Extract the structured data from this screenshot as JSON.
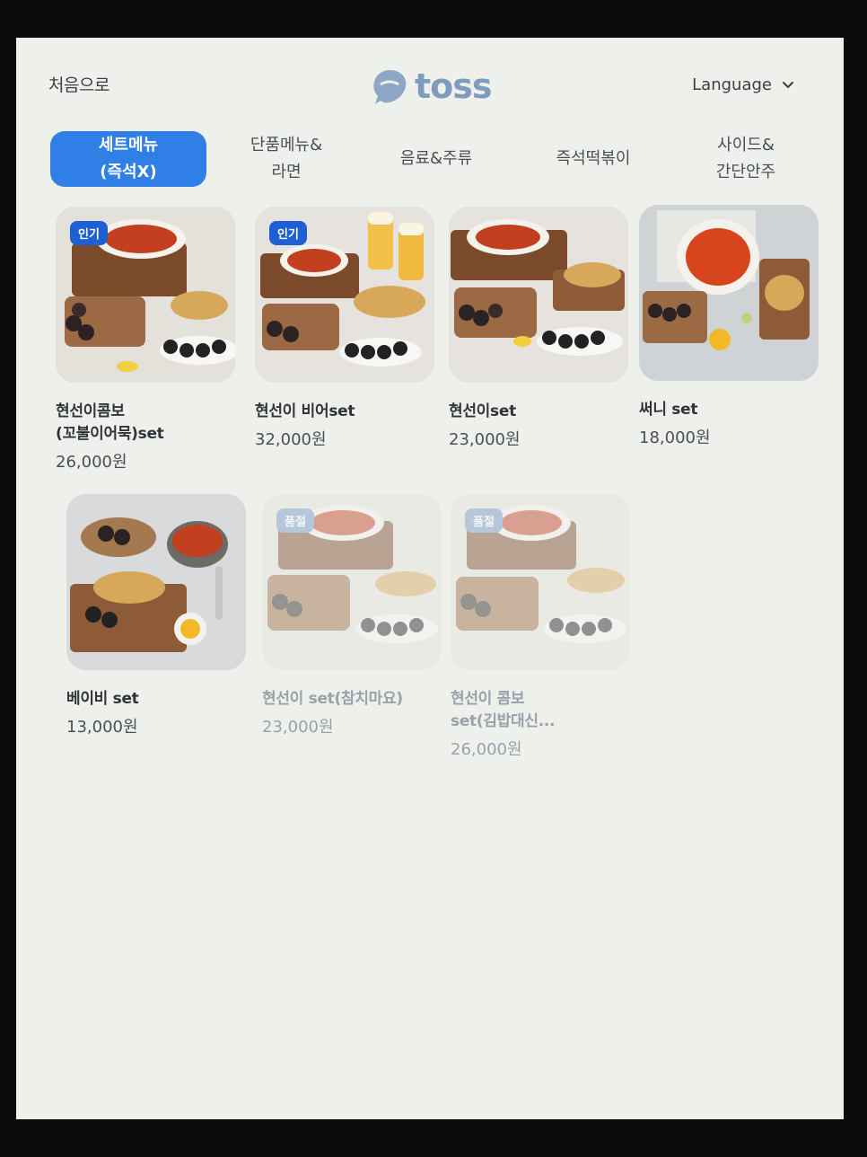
{
  "header": {
    "home_label": "처음으로",
    "brand": "toss",
    "language_label": "Language"
  },
  "tabs": [
    {
      "label": "세트메뉴\n(즉석X)",
      "active": true
    },
    {
      "label": "단품메뉴&\n라면",
      "active": false
    },
    {
      "label": "음료&주류",
      "active": false
    },
    {
      "label": "즉석떡볶이",
      "active": false
    },
    {
      "label": "사이드&\n간단안주",
      "active": false
    }
  ],
  "menu": [
    {
      "name": "현선이콤보\n(꼬불이어묵)set",
      "price": "26,000원",
      "badge": "인기",
      "sold_out": false
    },
    {
      "name": "현선이 비어set",
      "price": "32,000원",
      "badge": "인기",
      "sold_out": false
    },
    {
      "name": "현선이set",
      "price": "23,000원",
      "badge": "",
      "sold_out": false
    },
    {
      "name": "써니 set",
      "price": "18,000원",
      "badge": "",
      "sold_out": false
    },
    {
      "name": "베이비 set",
      "price": "13,000원",
      "badge": "",
      "sold_out": false
    },
    {
      "name": "현선이 set(참치마요)",
      "price": "23,000원",
      "badge": "품절",
      "sold_out": true
    },
    {
      "name": "현선이 콤보\nset(김밥대신...",
      "price": "26,000원",
      "badge": "품절",
      "sold_out": true
    }
  ],
  "colors": {
    "accent": "#2f7fe6",
    "brand": "#7f9bbd",
    "screen_bg": "#eef0ec"
  }
}
